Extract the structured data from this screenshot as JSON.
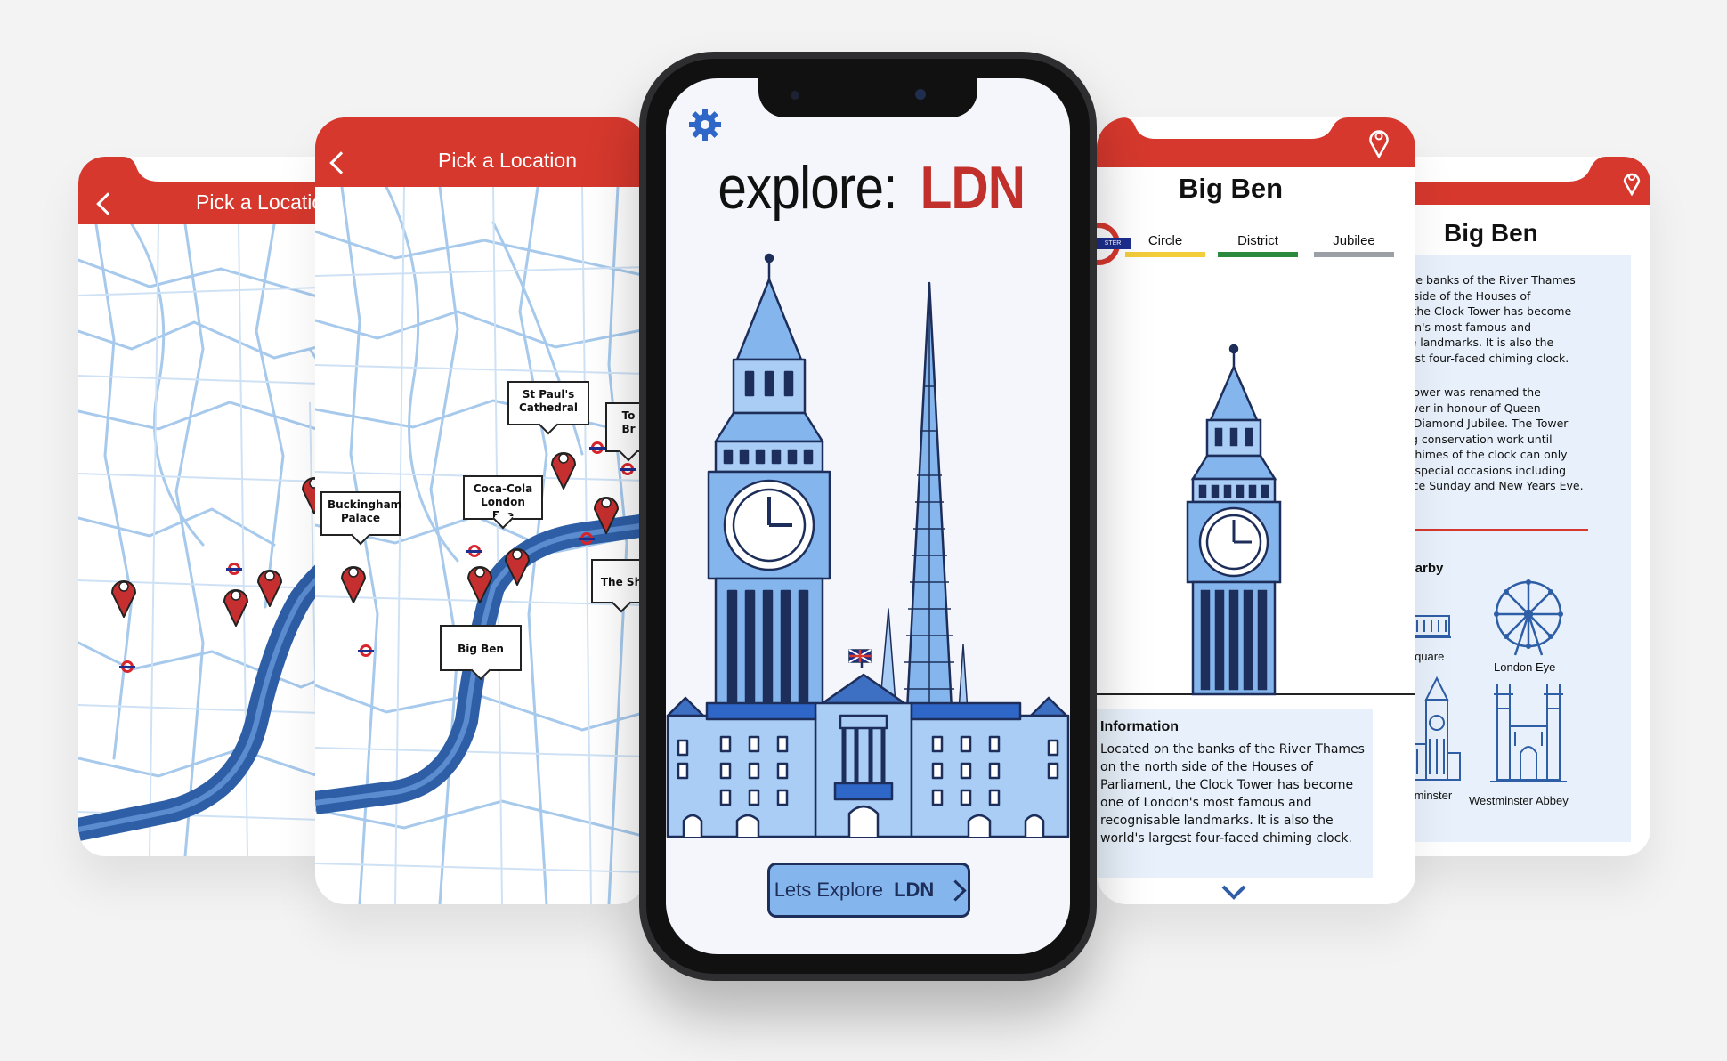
{
  "colors": {
    "brand_red": "#d6382d",
    "sky_blue": "#84b5ec",
    "navy": "#1d2e5a",
    "river": "#2e5ea6"
  },
  "map_back": {
    "title": "Pick a Location"
  },
  "map_front": {
    "title": "Pick a Location",
    "callouts": {
      "st_pauls": "St Paul's\nCathedral",
      "buckingham": "Buckingham\nPalace",
      "coca_cola": "Coca-Cola\nLondon Eye",
      "big_ben": "Big Ben",
      "the_shard": "The Sh",
      "tower": "To\nBr"
    }
  },
  "home": {
    "title_prefix": "explore: ",
    "title_accent": "LDN",
    "cta_prefix": "Lets Explore ",
    "cta_bold": "LDN"
  },
  "detail_front": {
    "title": "Big Ben",
    "station_badge": "STER",
    "lines": [
      {
        "name": "Circle",
        "color": "#f3cd3a"
      },
      {
        "name": "District",
        "color": "#2b8a3e"
      },
      {
        "name": "Jubilee",
        "color": "#9aa0a6"
      }
    ],
    "info_heading": "Information",
    "info_lines": [
      "Located on the banks of the River Thames",
      "on the north side of the Houses of",
      "Parliament, the Clock Tower has become",
      "one of London's most famous and",
      "recognisable landmarks. It is also the",
      "world's largest four-faced chiming clock."
    ]
  },
  "detail_back": {
    "title": "Big Ben",
    "p1": [
      "on the banks of the River Thames",
      "orth side of the Houses of",
      "ent, the Clock Tower has become",
      "ondon's most famous and",
      "sable landmarks. It is also the",
      "largest four-faced chiming clock."
    ],
    "p2": [
      " the tower was renamed the",
      "h Tower in honour of Queen",
      "hs II Diamond Jubilee. The Tower",
      "going conservation work until",
      " the chimes of the clock can only",
      "d on special occasions including",
      "brance Sunday and New Years Eve."
    ],
    "nearby_heading": "s Nearby",
    "nearby": [
      "gar Square",
      "London Eye",
      "f Westminster",
      "Westminster Abbey"
    ]
  }
}
